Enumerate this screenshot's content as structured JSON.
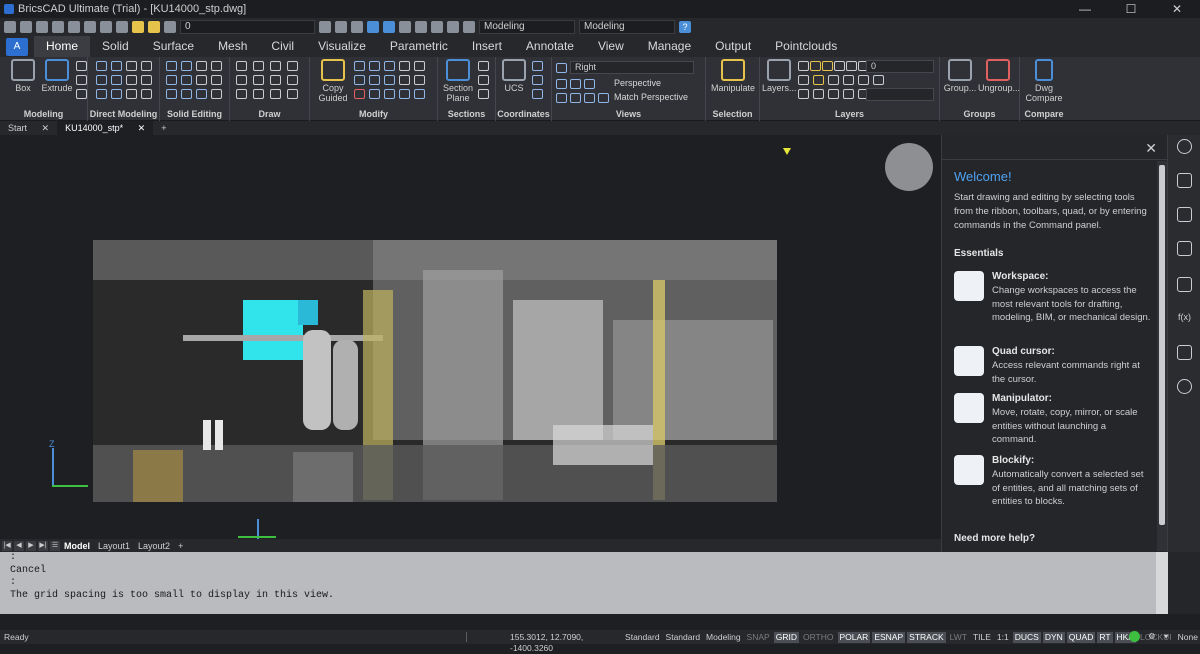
{
  "titlebar": {
    "title": "BricsCAD Ultimate (Trial) - [KU14000_stp.dwg]",
    "min": "—",
    "max": "☐",
    "close": "✕"
  },
  "qat": {
    "layer_value": "0",
    "workspace_1": "Modeling",
    "workspace_2": "Modeling",
    "help": "?"
  },
  "tabs": [
    {
      "label": "Home",
      "active": true
    },
    {
      "label": "Solid"
    },
    {
      "label": "Surface"
    },
    {
      "label": "Mesh"
    },
    {
      "label": "Civil"
    },
    {
      "label": "Visualize"
    },
    {
      "label": "Parametric"
    },
    {
      "label": "Insert"
    },
    {
      "label": "Annotate"
    },
    {
      "label": "View"
    },
    {
      "label": "Manage"
    },
    {
      "label": "Output"
    },
    {
      "label": "Pointclouds"
    }
  ],
  "ribbon": {
    "modeling": {
      "label": "Modeling",
      "box": "Box",
      "extrude": "Extrude"
    },
    "direct_modeling": {
      "label": "Direct Modeling"
    },
    "solid_editing": {
      "label": "Solid Editing"
    },
    "draw": {
      "label": "Draw"
    },
    "modify": {
      "label": "Modify",
      "copy_guided": "Copy Guided"
    },
    "sections": {
      "label": "Sections",
      "section_plane": "Section Plane"
    },
    "coordinates": {
      "label": "Coordinates",
      "ucs": "UCS"
    },
    "views": {
      "label": "Views",
      "view_select": "Right",
      "perspective": "Perspective",
      "match_perspective": "Match Perspective"
    },
    "selection": {
      "label": "Selection",
      "manipulate": "Manipulate"
    },
    "layers": {
      "label": "Layers",
      "layers_btn": "Layers...",
      "layer_value": "0"
    },
    "groups": {
      "label": "Groups",
      "group": "Group...",
      "ungroup": "Ungroup..."
    },
    "compare": {
      "label": "Compare",
      "dwg_compare": "Dwg Compare"
    }
  },
  "doctabs": [
    {
      "label": "Start"
    },
    {
      "label": "KU14000_stp*",
      "active": true
    }
  ],
  "viewport": {
    "axis_z": "Z"
  },
  "welcome": {
    "title": "Welcome!",
    "intro": "Start drawing and editing by selecting tools from the ribbon, toolbars, quad, or by entering commands in the Command panel.",
    "essentials": "Essentials",
    "items": [
      {
        "name": "Workspace:",
        "desc": "Change workspaces to access the most relevant tools for drafting, modeling, BIM, or mechanical design."
      },
      {
        "name": "Quad cursor:",
        "desc": "Access relevant commands right at the cursor."
      },
      {
        "name": "Manipulator:",
        "desc": "Move, rotate, copy, mirror, or scale entities without launching a command."
      },
      {
        "name": "Blockify:",
        "desc": "Automatically convert a selected set of entities, and all matching sets of entities to blocks."
      }
    ],
    "more_help": "Need more help?"
  },
  "layouttabs": [
    {
      "label": "Model",
      "active": true
    },
    {
      "label": "Layout1"
    },
    {
      "label": "Layout2"
    }
  ],
  "command_lines": [
    ":",
    "Cancel",
    ":",
    "The grid spacing is too small to display in this view."
  ],
  "status": {
    "ready": "Ready",
    "coords": "155.3012, 12.7090, -1400.3260",
    "items": [
      {
        "label": "Standard",
        "state": "plain"
      },
      {
        "label": "Standard",
        "state": "plain"
      },
      {
        "label": "Modeling",
        "state": "plain"
      },
      {
        "label": "SNAP",
        "state": "off"
      },
      {
        "label": "GRID",
        "state": "on"
      },
      {
        "label": "ORTHO",
        "state": "off"
      },
      {
        "label": "POLAR",
        "state": "on"
      },
      {
        "label": "ESNAP",
        "state": "on"
      },
      {
        "label": "STRACK",
        "state": "on"
      },
      {
        "label": "LWT",
        "state": "off"
      },
      {
        "label": "TILE",
        "state": "plain"
      },
      {
        "label": "1:1",
        "state": "plain"
      },
      {
        "label": "DUCS",
        "state": "on"
      },
      {
        "label": "DYN",
        "state": "on"
      },
      {
        "label": "QUAD",
        "state": "on"
      },
      {
        "label": "RT",
        "state": "on"
      },
      {
        "label": "HKA",
        "state": "on"
      },
      {
        "label": "LOCKUI",
        "state": "off"
      },
      {
        "label": "None",
        "state": "plain"
      }
    ]
  }
}
